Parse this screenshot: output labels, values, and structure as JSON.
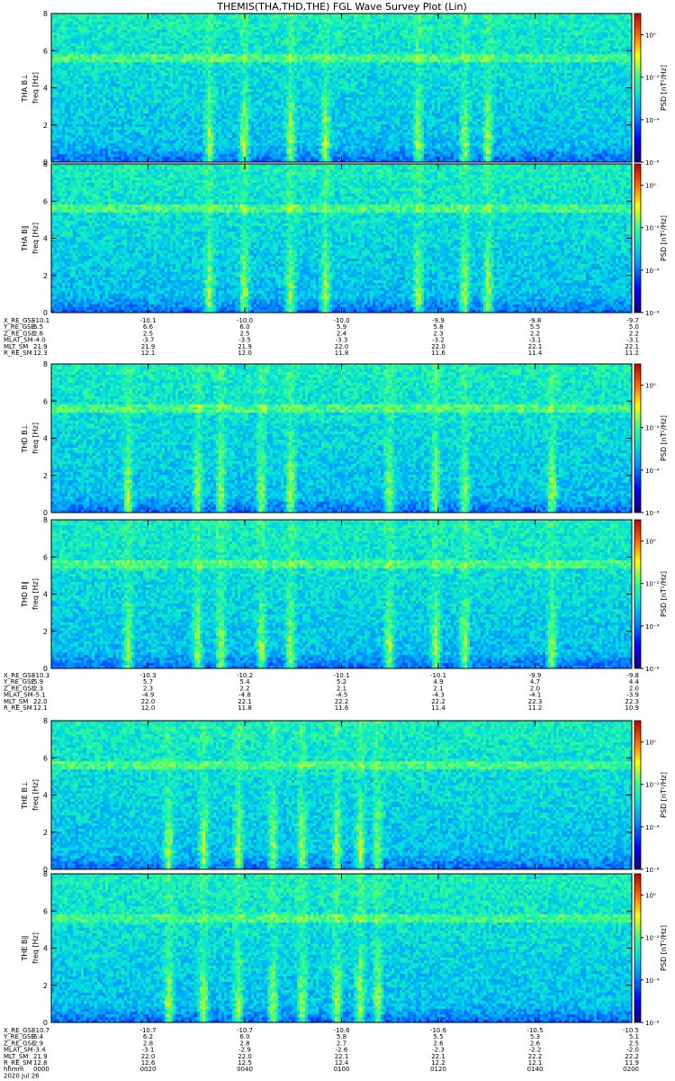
{
  "title": "THEMIS(THA,THD,THE) FGL Wave Survey Plot (Lin)",
  "colorbar_label": "PSD [nT²/Hz]",
  "colorbar_ticks": [
    "10⁰",
    "10⁻²",
    "10⁻⁴",
    "10⁻⁶"
  ],
  "chart_data": {
    "type": "heatmap",
    "title": "THEMIS(THA,THD,THE) FGL Wave Survey Plot (Lin)",
    "xlabel_rows": [
      "hhmm",
      "2020 Jul 26"
    ],
    "time_ticks": [
      "0000",
      "0020",
      "0040",
      "0100",
      "0120",
      "0140",
      "0200"
    ],
    "y_ticks": [
      0,
      2,
      4,
      6,
      8
    ],
    "ylim": [
      0,
      8
    ],
    "colorbar_range_log10": [
      -6,
      1
    ],
    "panels": [
      {
        "probe": "THA",
        "label": "THA B⊥",
        "ylabel": "freq [Hz]",
        "bursts": [
          0.27,
          0.33,
          0.41,
          0.47,
          0.63,
          0.71,
          0.75
        ]
      },
      {
        "probe": "THA",
        "label": "THA B∥",
        "ylabel": "freq [Hz]",
        "bursts": [
          0.27,
          0.33,
          0.41,
          0.47,
          0.63,
          0.71,
          0.75
        ]
      },
      {
        "probe": "THD",
        "label": "THD B⊥",
        "ylabel": "freq [Hz]",
        "bursts": [
          0.13,
          0.25,
          0.29,
          0.36,
          0.41,
          0.58,
          0.66,
          0.71,
          0.86
        ]
      },
      {
        "probe": "THD",
        "label": "THD B∥",
        "ylabel": "freq [Hz]",
        "bursts": [
          0.13,
          0.25,
          0.29,
          0.36,
          0.41,
          0.58,
          0.66,
          0.71,
          0.86
        ]
      },
      {
        "probe": "THE",
        "label": "THE B⊥",
        "ylabel": "freq [Hz]",
        "bursts": [
          0.2,
          0.26,
          0.32,
          0.38,
          0.43,
          0.49,
          0.53,
          0.56
        ]
      },
      {
        "probe": "THE",
        "label": "THE B∥",
        "ylabel": "freq [Hz]",
        "bursts": [
          0.2,
          0.26,
          0.32,
          0.38,
          0.43,
          0.49,
          0.53,
          0.56
        ]
      }
    ],
    "ephemeris": [
      {
        "probe": "THA",
        "rows": [
          {
            "name": "X_RE_GSE",
            "values": [
              "-10.1",
              "-10.1",
              "-10.0",
              "-10.0",
              "-9.9",
              "-9.8",
              "-9.7"
            ]
          },
          {
            "name": "Y_RE_GSE",
            "values": [
              "6.5",
              "6.6",
              "6.0",
              "5.9",
              "5.8",
              "5.5",
              "5.0"
            ]
          },
          {
            "name": "Z_RE_GSE",
            "values": [
              "2.6",
              "2.5",
              "2.5",
              "2.4",
              "2.3",
              "2.2",
              "2.2"
            ]
          },
          {
            "name": "MLAT_SM",
            "values": [
              "-4.0",
              "-3.7",
              "-3.5",
              "-3.3",
              "-3.2",
              "-3.1",
              "-3.1"
            ]
          },
          {
            "name": "MLT_SM",
            "values": [
              "21.9",
              "21.9",
              "21.9",
              "22.0",
              "22.0",
              "22.1",
              "22.1"
            ]
          },
          {
            "name": "R_RE_SM",
            "values": [
              "12.3",
              "12.1",
              "12.0",
              "11.8",
              "11.6",
              "11.4",
              "11.2"
            ]
          }
        ]
      },
      {
        "probe": "THD",
        "rows": [
          {
            "name": "X_RE_GSE",
            "values": [
              "-10.3",
              "-10.3",
              "-10.2",
              "-10.1",
              "-10.1",
              "-9.9",
              "-9.8"
            ]
          },
          {
            "name": "Y_RE_GSE",
            "values": [
              "5.9",
              "5.7",
              "5.4",
              "5.2",
              "4.9",
              "4.7",
              "4.4"
            ]
          },
          {
            "name": "Z_RE_GSE",
            "values": [
              "2.3",
              "2.3",
              "2.2",
              "2.1",
              "2.1",
              "2.0",
              "2.0"
            ]
          },
          {
            "name": "MLAT_SM",
            "values": [
              "-5.1",
              "-4.9",
              "-4.8",
              "-4.5",
              "-4.3",
              "-4.1",
              "-3.9"
            ]
          },
          {
            "name": "MLT_SM",
            "values": [
              "22.0",
              "22.0",
              "22.1",
              "22.2",
              "22.2",
              "22.3",
              "22.3"
            ]
          },
          {
            "name": "R_RE_SM",
            "values": [
              "12.1",
              "12.0",
              "11.8",
              "11.6",
              "11.4",
              "11.2",
              "10.9"
            ]
          }
        ]
      },
      {
        "probe": "THE",
        "rows": [
          {
            "name": "X_RE_GSE",
            "values": [
              "-10.7",
              "-10.7",
              "-10.7",
              "-10.6",
              "-10.6",
              "-10.5",
              "-10.5"
            ]
          },
          {
            "name": "Y_RE_GSE",
            "values": [
              "6.4",
              "6.2",
              "6.0",
              "5.8",
              "5.5",
              "5.3",
              "5.1"
            ]
          },
          {
            "name": "Z_RE_GSE",
            "values": [
              "2.9",
              "2.8",
              "2.8",
              "2.7",
              "2.6",
              "2.6",
              "2.5"
            ]
          },
          {
            "name": "MLAT_SM",
            "values": [
              "-3.4",
              "-3.1",
              "-2.9",
              "-2.6",
              "-2.3",
              "-2.2",
              "-2.0"
            ]
          },
          {
            "name": "MLT_SM",
            "values": [
              "21.9",
              "22.0",
              "22.0",
              "22.1",
              "22.1",
              "22.2",
              "22.2"
            ]
          },
          {
            "name": "R_RE_SM",
            "values": [
              "12.8",
              "12.6",
              "12.5",
              "12.4",
              "12.2",
              "12.1",
              "11.9"
            ]
          }
        ]
      }
    ]
  }
}
